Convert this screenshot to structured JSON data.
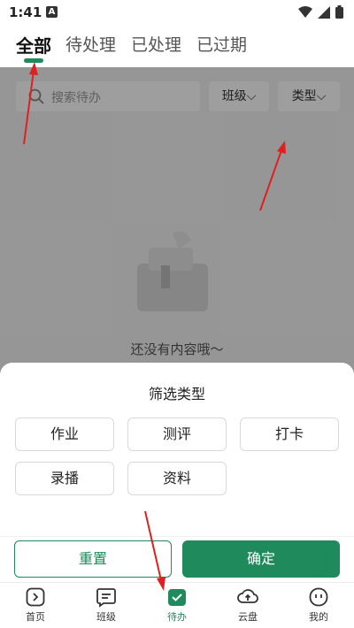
{
  "status_bar": {
    "time": "1:41",
    "notification_badge": "A"
  },
  "tabs": [
    {
      "label": "全部",
      "active": true
    },
    {
      "label": "待处理",
      "active": false
    },
    {
      "label": "已处理",
      "active": false
    },
    {
      "label": "已过期",
      "active": false
    }
  ],
  "search": {
    "placeholder": "搜索待办"
  },
  "filters": {
    "class_label": "班级",
    "type_label": "类型"
  },
  "empty_state": {
    "text": "还没有内容哦～"
  },
  "sheet": {
    "title": "筛选类型",
    "options": [
      {
        "label": "作业"
      },
      {
        "label": "测评"
      },
      {
        "label": "打卡"
      },
      {
        "label": "录播"
      },
      {
        "label": "资料"
      }
    ],
    "reset_label": "重置",
    "confirm_label": "确定"
  },
  "nav": [
    {
      "label": "首页",
      "icon": "home-icon",
      "active": false
    },
    {
      "label": "班级",
      "icon": "class-icon",
      "active": false
    },
    {
      "label": "待办",
      "icon": "todo-icon",
      "active": true
    },
    {
      "label": "云盘",
      "icon": "cloud-icon",
      "active": false
    },
    {
      "label": "我的",
      "icon": "profile-icon",
      "active": false
    }
  ],
  "colors": {
    "accent": "#1f8a5c",
    "annotation": "#e02020"
  }
}
